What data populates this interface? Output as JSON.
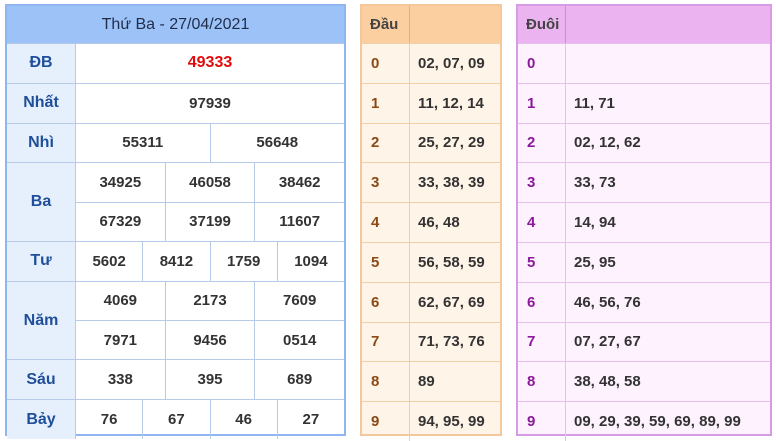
{
  "results": {
    "title": "Thứ Ba - 27/04/2021",
    "rows": [
      {
        "label": "ĐB",
        "lines": [
          [
            "49333"
          ]
        ]
      },
      {
        "label": "Nhất",
        "lines": [
          [
            "97939"
          ]
        ]
      },
      {
        "label": "Nhì",
        "lines": [
          [
            "55311",
            "56648"
          ]
        ]
      },
      {
        "label": "Ba",
        "lines": [
          [
            "34925",
            "46058",
            "38462"
          ],
          [
            "67329",
            "37199",
            "11607"
          ]
        ]
      },
      {
        "label": "Tư",
        "lines": [
          [
            "5602",
            "8412",
            "1759",
            "1094"
          ]
        ]
      },
      {
        "label": "Năm",
        "lines": [
          [
            "4069",
            "2173",
            "7609"
          ],
          [
            "7971",
            "9456",
            "0514"
          ]
        ]
      },
      {
        "label": "Sáu",
        "lines": [
          [
            "338",
            "395",
            "689"
          ]
        ]
      },
      {
        "label": "Bảy",
        "lines": [
          [
            "76",
            "67",
            "46",
            "27"
          ]
        ]
      }
    ]
  },
  "head_table": {
    "title": "Đầu",
    "rows": [
      {
        "key": "0",
        "values": "02, 07, 09"
      },
      {
        "key": "1",
        "values": "11, 12, 14"
      },
      {
        "key": "2",
        "values": "25, 27, 29"
      },
      {
        "key": "3",
        "values": "33, 38, 39"
      },
      {
        "key": "4",
        "values": "46, 48"
      },
      {
        "key": "5",
        "values": "56, 58, 59"
      },
      {
        "key": "6",
        "values": "62, 67, 69"
      },
      {
        "key": "7",
        "values": "71, 73, 76"
      },
      {
        "key": "8",
        "values": "89"
      },
      {
        "key": "9",
        "values": "94, 95, 99"
      }
    ]
  },
  "tail_table": {
    "title": "Đuôi",
    "rows": [
      {
        "key": "0",
        "values": ""
      },
      {
        "key": "1",
        "values": "11, 71"
      },
      {
        "key": "2",
        "values": "02, 12, 62"
      },
      {
        "key": "3",
        "values": "33, 73"
      },
      {
        "key": "4",
        "values": "14, 94"
      },
      {
        "key": "5",
        "values": "25, 95"
      },
      {
        "key": "6",
        "values": "46, 56, 76"
      },
      {
        "key": "7",
        "values": "07, 27, 67"
      },
      {
        "key": "8",
        "values": "38, 48, 58"
      },
      {
        "key": "9",
        "values": "09, 29, 39, 59, 69, 89, 99"
      }
    ]
  }
}
